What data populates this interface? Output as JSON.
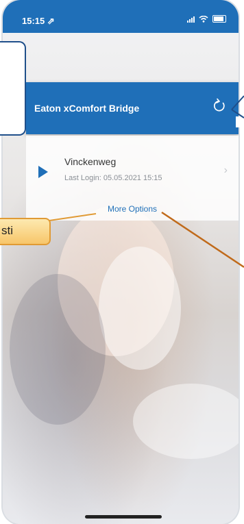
{
  "status_bar": {
    "time": "15:15 ⇗"
  },
  "bridge": {
    "title": "Eaton xComfort Bridge"
  },
  "home": {
    "name": "Vinckenweg",
    "last_login": "Last Login: 05.05.2021 15:15"
  },
  "more_options": "More Options",
  "callout": {
    "text": "sti"
  },
  "colors": {
    "accent": "#1f6fb8",
    "callout_fill": "#f7c66a",
    "callout_border": "#e09a34"
  }
}
